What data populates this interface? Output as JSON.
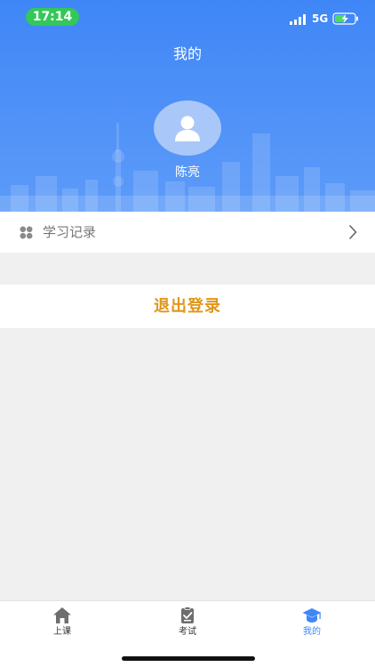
{
  "status_bar": {
    "time": "17:14",
    "network": "5G",
    "icons": [
      "signal-icon",
      "battery-charging-icon"
    ]
  },
  "header": {
    "title": "我的",
    "user_name": "陈亮",
    "avatar_icon": "user-silhouette-icon",
    "background_color": "#3f86f7"
  },
  "menu": {
    "items": [
      {
        "label": "学习记录",
        "icon": "grid-dots-icon",
        "trailing_icon": "chevron-right-icon"
      }
    ]
  },
  "logout": {
    "label": "退出登录",
    "color": "#e0961a"
  },
  "tab_bar": {
    "active_color": "#3f86f7",
    "tabs": [
      {
        "label": "上课",
        "icon": "home-icon",
        "active": false
      },
      {
        "label": "考试",
        "icon": "clipboard-check-icon",
        "active": false
      },
      {
        "label": "我的",
        "icon": "graduation-cap-icon",
        "active": true
      }
    ]
  }
}
